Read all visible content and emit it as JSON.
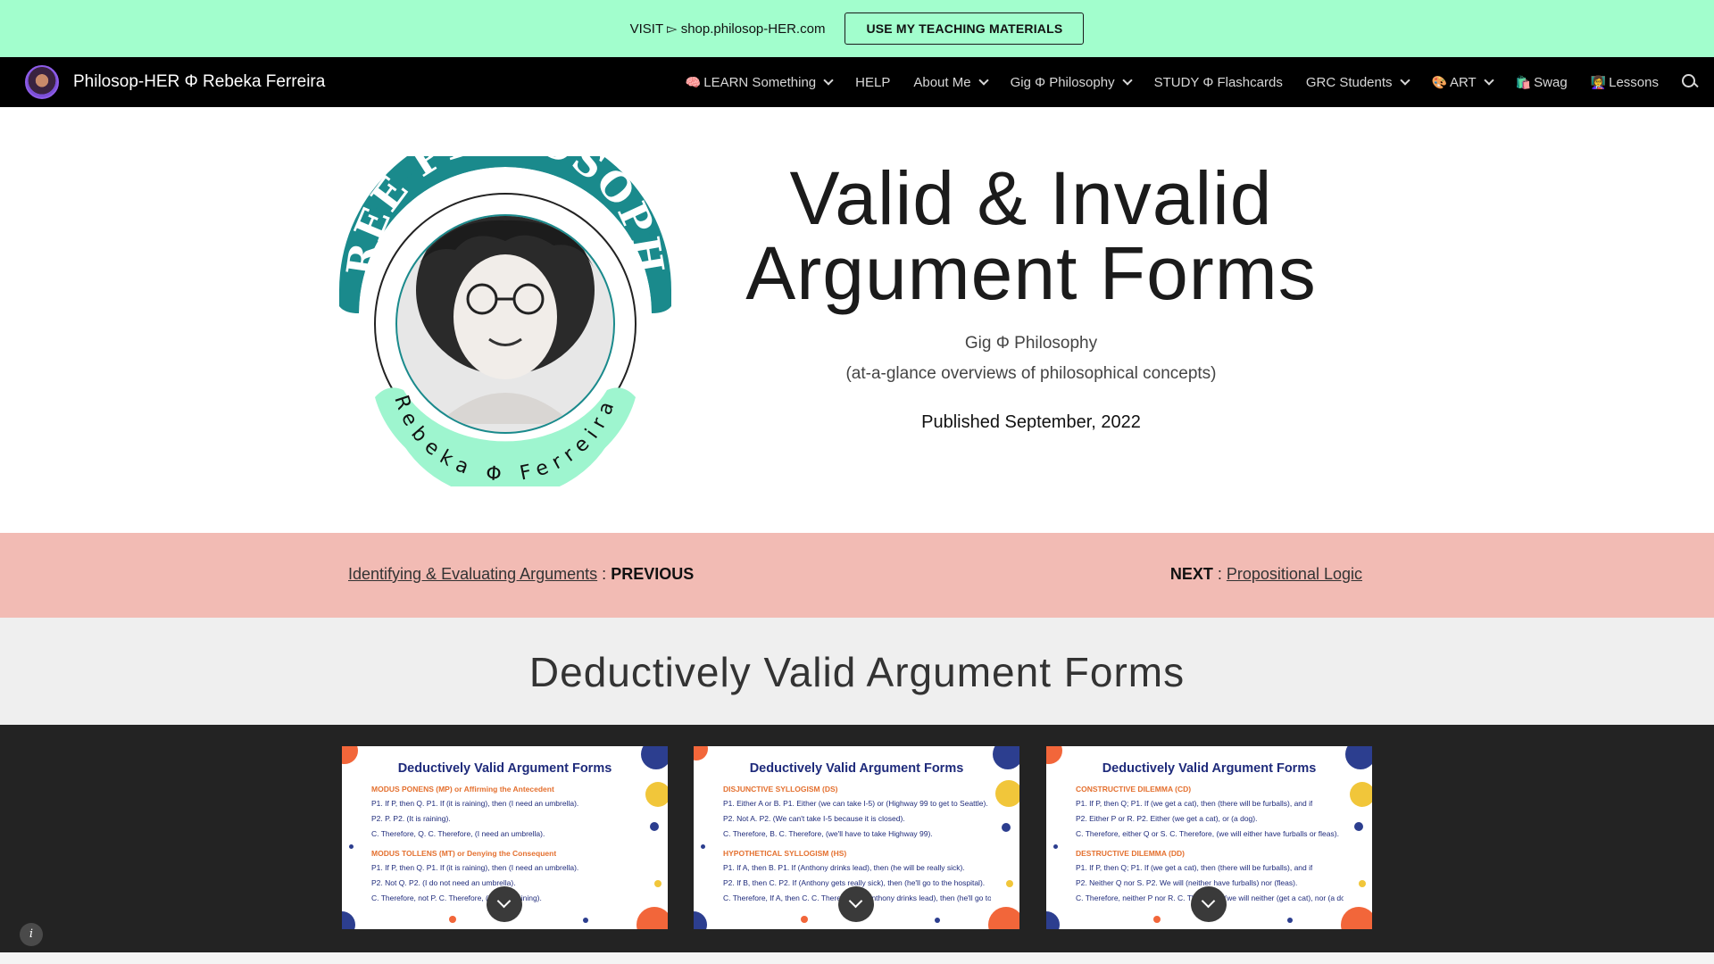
{
  "announcement": {
    "text": "VISIT ▻ shop.philosop-HER.com",
    "button_label": "USE MY TEACHING MATERIALS"
  },
  "nav": {
    "site_title": "Philosop-HER Φ Rebeka Ferreira",
    "items": [
      {
        "emoji": "🧠",
        "label": "LEARN Something",
        "dropdown": true
      },
      {
        "emoji": "",
        "label": "HELP",
        "dropdown": false
      },
      {
        "emoji": "",
        "label": "About Me",
        "dropdown": true
      },
      {
        "emoji": "",
        "label": "Gig Φ Philosophy",
        "dropdown": true
      },
      {
        "emoji": "",
        "label": "STUDY Φ Flashcards",
        "dropdown": false
      },
      {
        "emoji": "",
        "label": "GRC Students",
        "dropdown": true
      },
      {
        "emoji": "🎨",
        "label": "ART",
        "dropdown": true
      },
      {
        "emoji": "🛍️",
        "label": "Swag",
        "dropdown": false
      },
      {
        "emoji": "👩‍🏫",
        "label": "Lessons",
        "dropdown": false
      }
    ]
  },
  "hero": {
    "badge_top_text": "FREE PHILOSOPHY",
    "badge_bottom_text": "Rebeka Φ Ferreira",
    "title_line1": "Valid & Invalid",
    "title_line2": "Argument Forms",
    "subtitle": "Gig Φ Philosophy",
    "tagline": "(at-a-glance overviews of philosophical concepts)",
    "published": "Published September, 2022"
  },
  "prev_next": {
    "prev_link": "Identifying & Evaluating Arguments",
    "prev_sep": " : ",
    "prev_label": "PREVIOUS",
    "next_label": "NEXT",
    "next_sep": " : ",
    "next_link": "Propositional Logic"
  },
  "section": {
    "title": "Deductively Valid Argument Forms"
  },
  "gallery": {
    "cards": [
      {
        "title": "Deductively Valid Argument Forms",
        "lines": [
          {
            "kind": "h",
            "text": "MODUS PONENS (MP) or Affirming the Antecedent"
          },
          {
            "kind": "t",
            "text": "P1. If P, then Q.          P1. If (it is raining), then (I need an umbrella)."
          },
          {
            "kind": "t",
            "text": "P2. P.                      P2. (It is raining)."
          },
          {
            "kind": "t",
            "text": "C. Therefore, Q.         C. Therefore, (I need an umbrella)."
          },
          {
            "kind": "h",
            "text": "MODUS TOLLENS (MT) or Denying the Consequent"
          },
          {
            "kind": "t",
            "text": "P1. If P, then Q.          P1. If (it is raining), then (I need an umbrella)."
          },
          {
            "kind": "t",
            "text": "P2. Not Q.                 P2. (I do not need an umbrella)."
          },
          {
            "kind": "t",
            "text": "C. Therefore, not P.    C. Therefore, (it is not raining)."
          }
        ]
      },
      {
        "title": "Deductively Valid Argument Forms",
        "lines": [
          {
            "kind": "h",
            "text": "DISJUNCTIVE SYLLOGISM (DS)"
          },
          {
            "kind": "t",
            "text": "P1. Either A or B.     P1. Either (we can take I-5) or (Highway 99 to get to Seattle)."
          },
          {
            "kind": "t",
            "text": "P2. Not A.                P2. (We can't take I-5 because it is closed)."
          },
          {
            "kind": "t",
            "text": "C. Therefore, B.        C. Therefore, (we'll have to take Highway 99)."
          },
          {
            "kind": "h",
            "text": "HYPOTHETICAL SYLLOGISM (HS)"
          },
          {
            "kind": "t",
            "text": "P1. If A, then B.        P1. If (Anthony drinks lead), then (he will be really sick)."
          },
          {
            "kind": "t",
            "text": "P2. If B, then C.        P2. If (Anthony gets really sick), then (he'll go to the hospital)."
          },
          {
            "kind": "t",
            "text": "C. Therefore, If A, then C.  C. Therefore, if (Anthony drinks lead), then (he'll go to the hospital)."
          }
        ]
      },
      {
        "title": "Deductively Valid Argument Forms",
        "lines": [
          {
            "kind": "h",
            "text": "CONSTRUCTIVE DILEMMA (CD)"
          },
          {
            "kind": "t",
            "text": "P1. If P, then Q;           P1. If (we get a cat), then (there will be furballs), and if"
          },
          {
            "kind": "t",
            "text": "P2. Either P or R.         P2. Either (we get a cat), or (a dog)."
          },
          {
            "kind": "t",
            "text": "C. Therefore, either Q or S.  C. Therefore, (we will either have furballs or fleas)."
          },
          {
            "kind": "h",
            "text": "DESTRUCTIVE DILEMMA (DD)"
          },
          {
            "kind": "t",
            "text": "P1. If P, then Q;           P1. If (we get a cat), then (there will be furballs), and if"
          },
          {
            "kind": "t",
            "text": "P2. Neither Q nor S.      P2. We will (neither have furballs) nor (fleas)."
          },
          {
            "kind": "t",
            "text": "C. Therefore, neither P nor R.  C. Therefore, (we will neither (get a cat), nor (a dog)."
          }
        ]
      }
    ]
  },
  "colors": {
    "announcement_bg": "#a2fecd",
    "nav_bg": "#000000",
    "prev_next_bg": "#f2bbb4",
    "section_bg": "#efefef",
    "gallery_bg": "#232323",
    "badge_teal": "#1a8a8c",
    "badge_mint": "#9ef5cf"
  }
}
